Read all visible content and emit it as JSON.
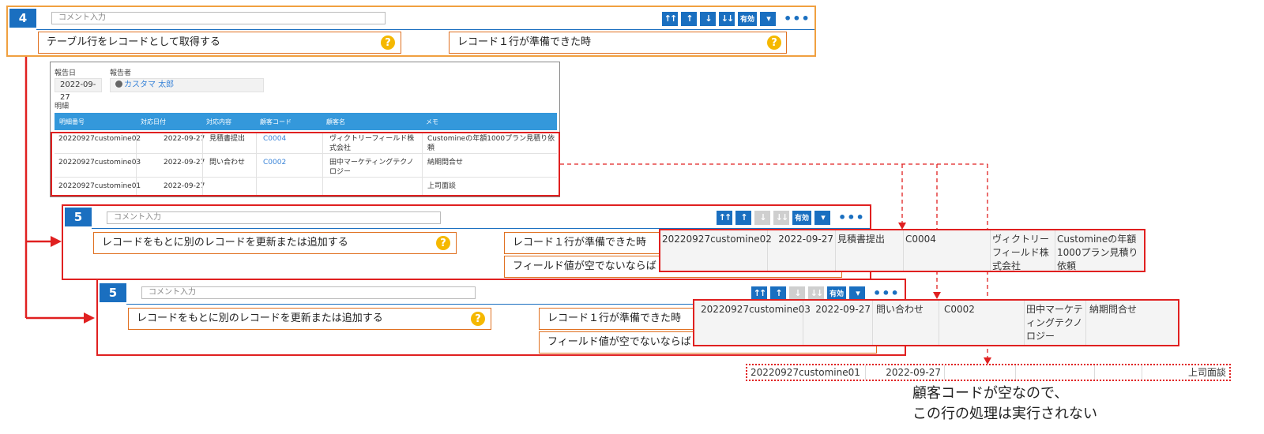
{
  "step4": {
    "number": "4",
    "comment_placeholder": "コメント入力",
    "action": "テーブル行をレコードとして取得する",
    "condition": "レコード１行が準備できた時",
    "enabled_label": "有効"
  },
  "step5a": {
    "number": "5",
    "comment_placeholder": "コメント入力",
    "action": "レコードをもとに別のレコードを更新または追加する",
    "condition1": "レコード１行が準備できた時",
    "condition2": "フィールド値が空でないならば",
    "enabled_label": "有効"
  },
  "step5b": {
    "number": "5",
    "comment_placeholder": "コメント入力",
    "action": "レコードをもとに別のレコードを更新または追加する",
    "condition1": "レコード１行が準備できた時",
    "condition2": "フィールド値が空でないならば",
    "enabled_label": "有効"
  },
  "record": {
    "report_date_label": "報告日",
    "report_date": "2022-09-27",
    "reporter_label": "報告者",
    "reporter": "カスタマ 太郎",
    "detail_label": "明細",
    "columns": [
      "明細番号",
      "対応日付",
      "対応内容",
      "顧客コード",
      "顧客名",
      "メモ"
    ],
    "rows": [
      {
        "id": "20220927customine02",
        "date": "2022-09-27",
        "content": "見積書提出",
        "code": "C0004",
        "customer": "ヴィクトリーフィールド株式会社",
        "memo": "Customineの年額1000プラン見積り依頼"
      },
      {
        "id": "20220927customine03",
        "date": "2022-09-27",
        "content": "問い合わせ",
        "code": "C0002",
        "customer": "田中マーケティングテクノロジー",
        "memo": "納期問合せ"
      },
      {
        "id": "20220927customine01",
        "date": "2022-09-27",
        "content": "",
        "code": "",
        "customer": "",
        "memo": "上司面談"
      }
    ]
  },
  "callout1": {
    "id": "20220927customine02",
    "date": "2022-09-27",
    "content": "見積書提出",
    "code": "C0004",
    "customer": "ヴィクトリーフィールド株式会社",
    "memo": "Customineの年額1000プラン見積り依頼"
  },
  "callout2": {
    "id": "20220927customine03",
    "date": "2022-09-27",
    "content": "問い合わせ",
    "code": "C0002",
    "customer": "田中マーケティングテクノロジー",
    "memo": "納期問合せ"
  },
  "callout3": {
    "id": "20220927customine01",
    "date": "2022-09-27",
    "memo": "上司面談"
  },
  "note": {
    "line1": "顧客コードが空なので、",
    "line2": "この行の処理は実行されない"
  },
  "colors": {
    "accent": "#1a6fc0",
    "highlight": "#e02020",
    "step_border": "#f0a040",
    "help": "#f5b800"
  }
}
